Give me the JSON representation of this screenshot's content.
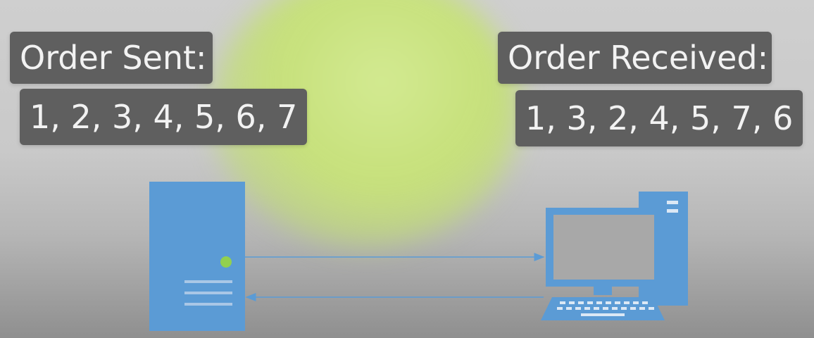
{
  "sender": {
    "title": "Order Sent:",
    "sequence": "1, 2, 3, 4, 5, 6, 7"
  },
  "receiver": {
    "title": "Order Received:",
    "sequence": "1, 3, 2, 4, 5, 7, 6"
  },
  "colors": {
    "device_blue": "#5b9bd5",
    "device_blue_dark": "#4a86bf",
    "status_led": "#92d050",
    "label_bg": "#5f5f5f",
    "label_text": "#f2f2f2",
    "screen_gray": "#a8a8a8"
  },
  "icons": {
    "server": "server-icon",
    "computer": "desktop-computer-icon"
  }
}
